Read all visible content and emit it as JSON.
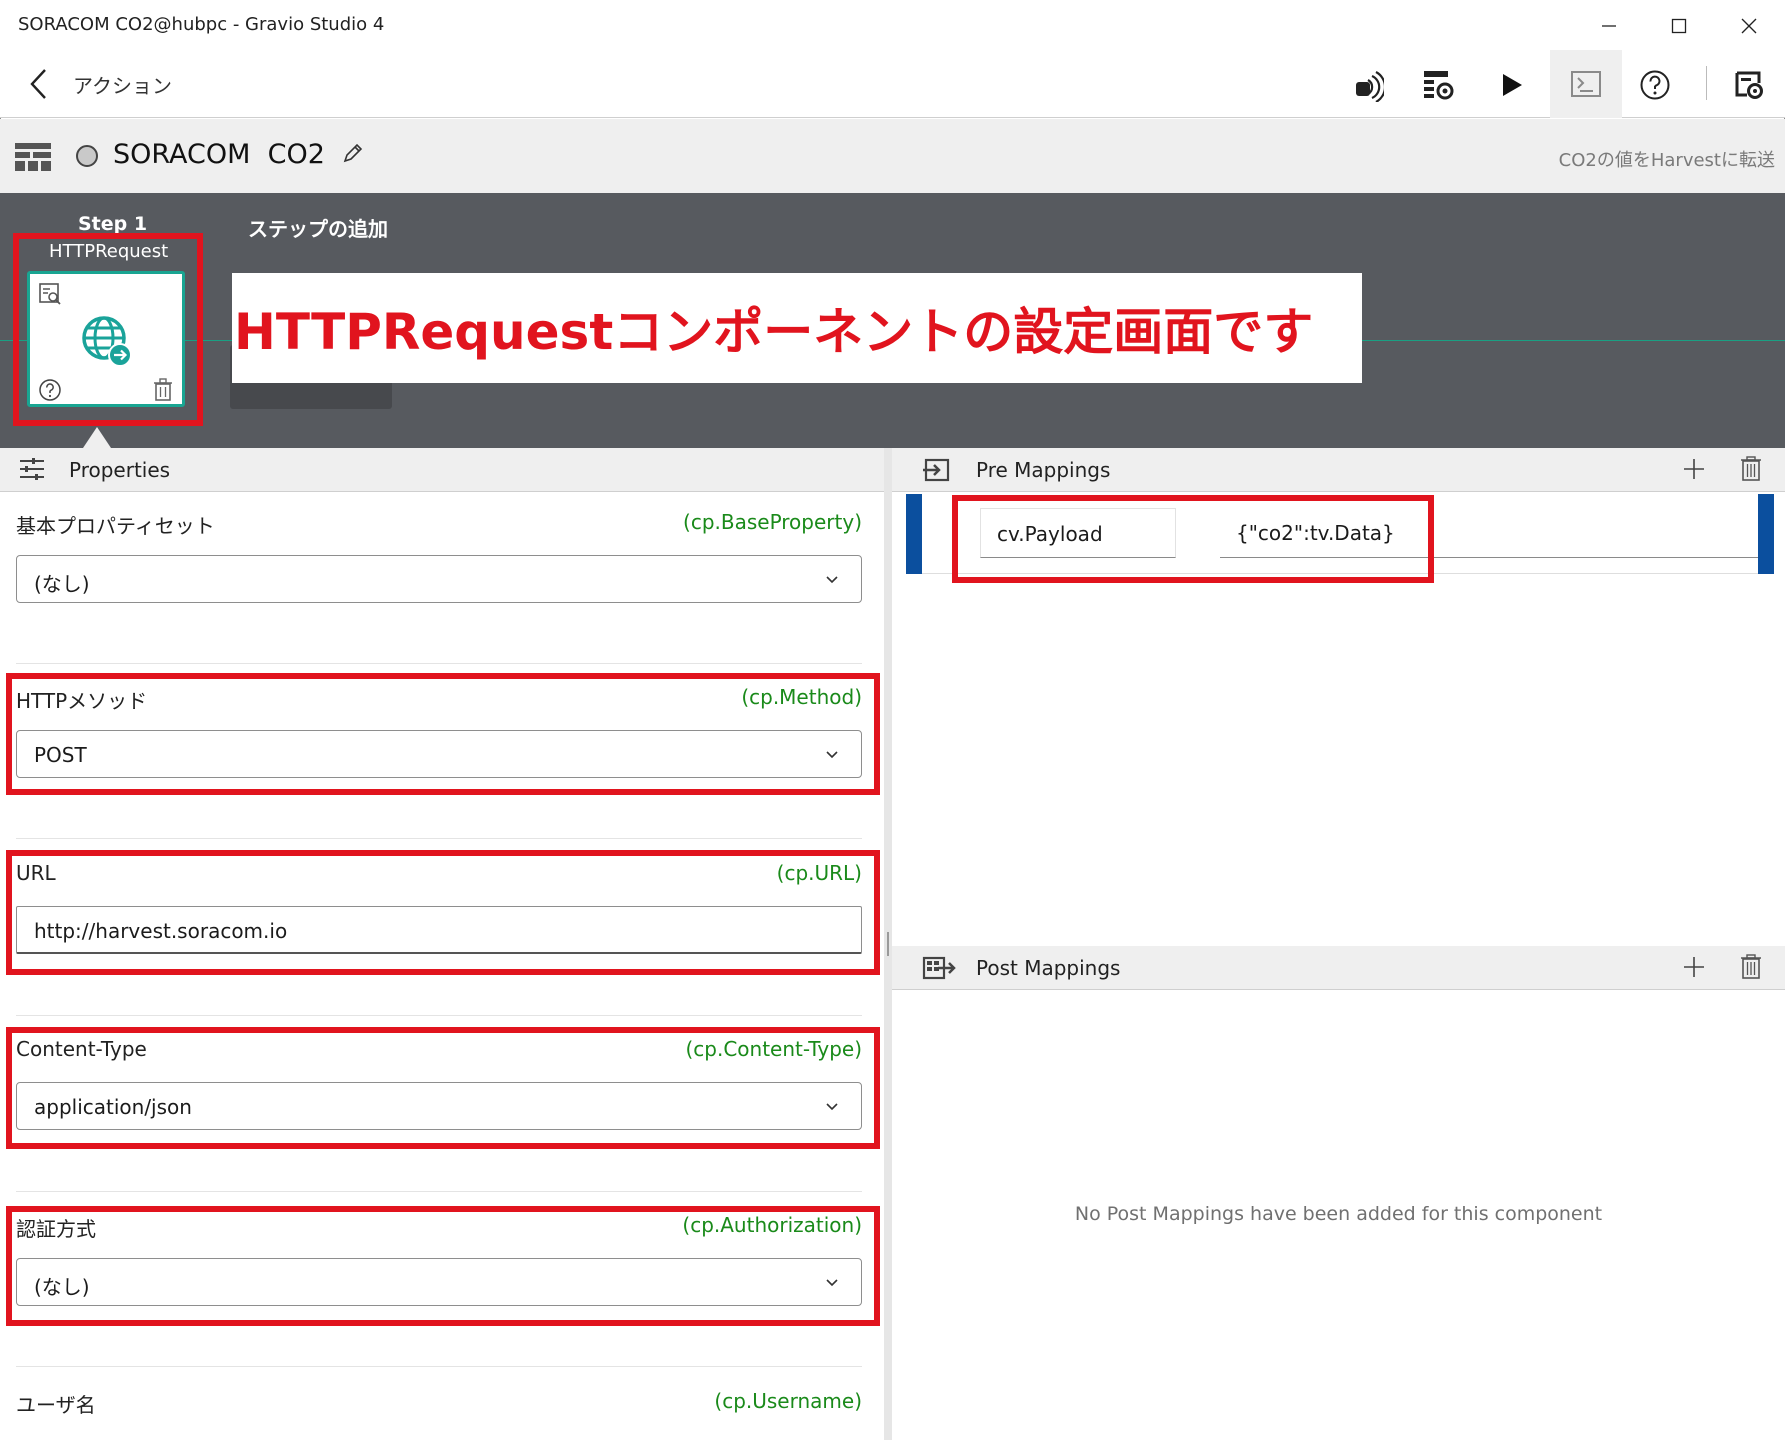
{
  "window": {
    "title": "SORACOM  CO2@hubpc - Gravio Studio 4"
  },
  "appbar": {
    "section": "アクション"
  },
  "header": {
    "action_name": "SORACOM  CO2",
    "description": "CO2の値をHarvestに転送"
  },
  "steps": {
    "step_label": "Step 1",
    "add_step": "ステップの追加",
    "component_name": "HTTPRequest"
  },
  "callout": "HTTPRequestコンポーネントの設定画面です",
  "properties": {
    "title": "Properties",
    "items": [
      {
        "label": "基本プロパティセット",
        "key": "(cp.BaseProperty)",
        "value": "(なし)",
        "type": "select"
      },
      {
        "label": "HTTPメソッド",
        "key": "(cp.Method)",
        "value": "POST",
        "type": "select"
      },
      {
        "label": "URL",
        "key": "(cp.URL)",
        "value": "http://harvest.soracom.io",
        "type": "text"
      },
      {
        "label": "Content-Type",
        "key": "(cp.Content-Type)",
        "value": "application/json",
        "type": "select"
      },
      {
        "label": "認証方式",
        "key": "(cp.Authorization)",
        "value": "(なし)",
        "type": "select"
      },
      {
        "label": "ユーザ名",
        "key": "(cp.Username)",
        "value": "",
        "type": "text"
      }
    ]
  },
  "pre_mappings": {
    "title": "Pre Mappings",
    "rows": [
      {
        "key": "cv.Payload",
        "value": "{\"co2\":tv.Data}"
      }
    ]
  },
  "post_mappings": {
    "title": "Post Mappings",
    "empty_message": "No Post Mappings have been added for this component"
  },
  "colors": {
    "accent_teal": "#19a592",
    "annotation_red": "#e1141e",
    "key_green": "#1a8a1a",
    "step_bg": "#575a5f",
    "mapping_edge": "#0b4f9e"
  }
}
